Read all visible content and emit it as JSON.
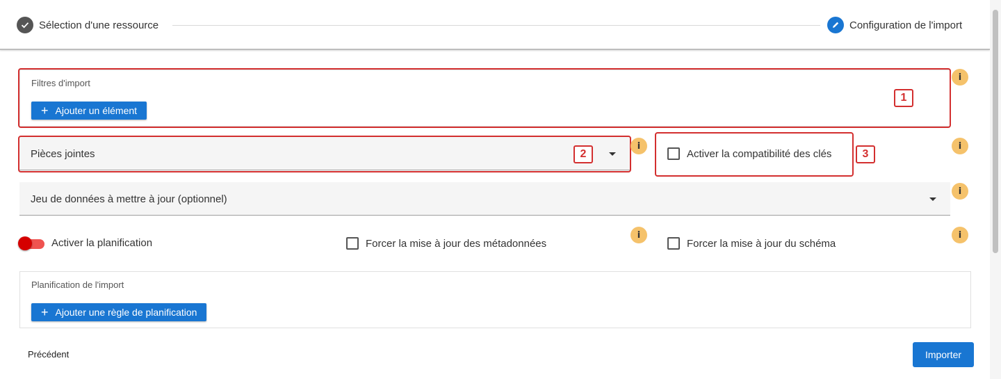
{
  "stepper": {
    "step1_label": "Sélection d'une ressource",
    "step1_icon": "check-icon",
    "step2_label": "Configuration de l'import",
    "step2_icon": "pencil-icon"
  },
  "filtres": {
    "label": "Filtres d'import",
    "add_button": "Ajouter un élément",
    "annotation": "1"
  },
  "attachments_select": {
    "value": "Pièces jointes",
    "annotation": "2"
  },
  "key_compat": {
    "label": "Activer la compatibilité des clés",
    "checked": false,
    "annotation": "3"
  },
  "dataset_select": {
    "placeholder": "Jeu de données à mettre à jour (optionnel)"
  },
  "planification_toggle": {
    "label": "Activer la planification",
    "on": false
  },
  "force_metadata": {
    "label": "Forcer la mise à jour des métadonnées",
    "checked": false
  },
  "force_schema": {
    "label": "Forcer la mise à jour du schéma",
    "checked": false
  },
  "planification": {
    "label": "Planification de l'import",
    "add_button": "Ajouter une règle de planification"
  },
  "info_icon_text": "i",
  "footer": {
    "previous": "Précédent",
    "import": "Importer"
  },
  "colors": {
    "primary": "#1976d2",
    "annotation_red": "#d32f2f",
    "info_orange": "#f5c26b",
    "toggle_red": "#d50000"
  }
}
